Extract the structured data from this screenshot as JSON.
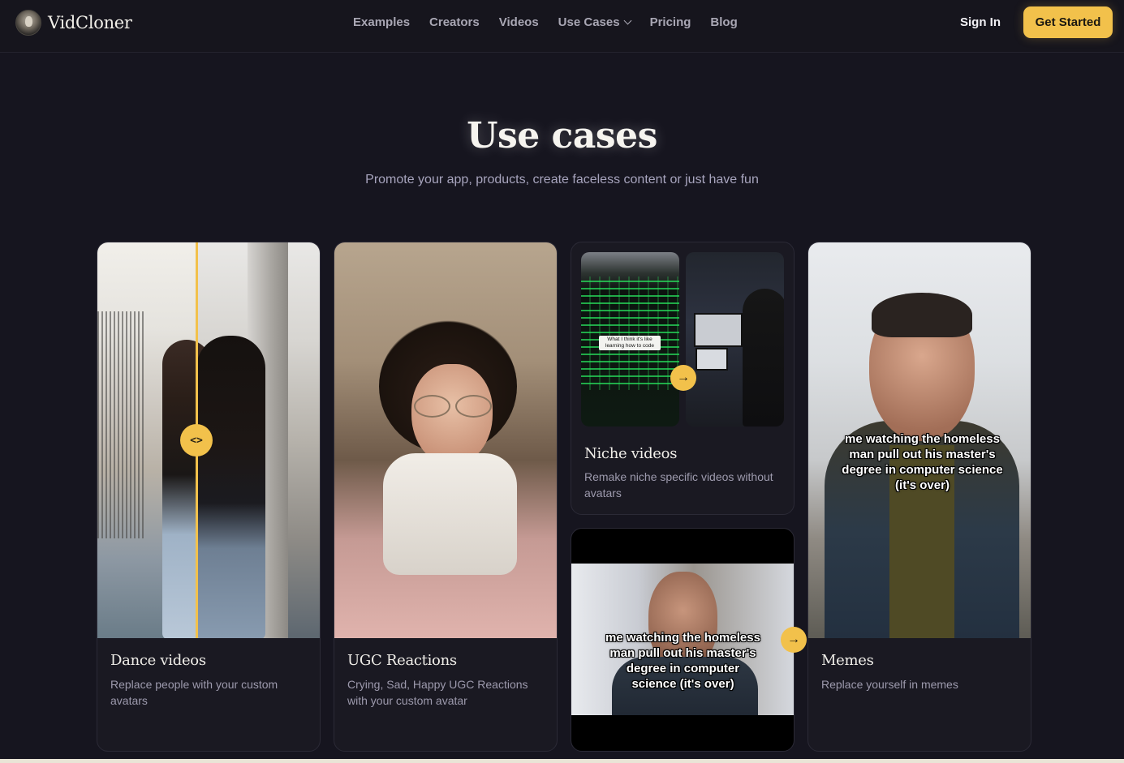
{
  "nav": {
    "brand": "VidCloner",
    "links": [
      "Examples",
      "Creators",
      "Videos",
      "Use Cases",
      "Pricing",
      "Blog"
    ],
    "signin": "Sign In",
    "cta": "Get Started"
  },
  "hero": {
    "title": "Use cases",
    "subtitle": "Promote your app, products, create faceless content or just have fun"
  },
  "cards": {
    "dance": {
      "title": "Dance videos",
      "desc": "Replace people with your custom avatars",
      "slider_icon": "<>"
    },
    "ugc": {
      "title": "UGC Reactions",
      "desc": "Crying, Sad, Happy UGC Reactions with your custom avatar"
    },
    "niche": {
      "title": "Niche videos",
      "desc": "Remake niche specific videos without avatars",
      "caption": "What I think it's like learning how to code"
    },
    "meme_video": {
      "caption": "me watching the homeless man pull out his master's degree in computer science (it's over)"
    },
    "memes": {
      "title": "Memes",
      "desc": "Replace yourself in memes",
      "caption": "me watching the homeless man pull out his master's degree in computer science (it's over)"
    }
  },
  "colors": {
    "accent": "#f2c14b",
    "background": "#16151f"
  },
  "icons": [
    "logo-icon",
    "chevron-down-icon",
    "slider-handle-icon",
    "arrow-right-icon"
  ]
}
